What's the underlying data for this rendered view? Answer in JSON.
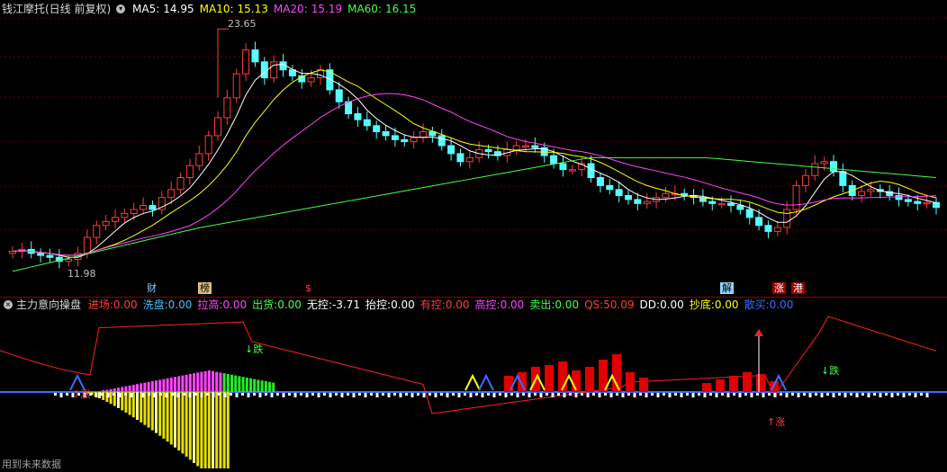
{
  "main_panel": {
    "title": "钱江摩托(日线 前复权)",
    "ma": [
      {
        "label": "MA5:",
        "value": "14.95",
        "color": "#ffffff"
      },
      {
        "label": "MA10:",
        "value": "15.13",
        "color": "#ffff00"
      },
      {
        "label": "MA20:",
        "value": "15.19",
        "color": "#ff44ff"
      },
      {
        "label": "MA60:",
        "value": "16.15",
        "color": "#44ff44"
      }
    ],
    "high_label": "23.65",
    "low_label": "11.98",
    "event_tags": [
      {
        "text": "财",
        "color": "#7fd0ff",
        "bg": "transparent"
      },
      {
        "text": "榜",
        "color": "#000000",
        "bg": "#d9c07a"
      },
      {
        "text": "$",
        "color": "#ff3b3b",
        "bg": "transparent"
      },
      {
        "text": "解",
        "color": "#000000",
        "bg": "#8fd8ff"
      },
      {
        "text": "涨",
        "color": "#ffffff",
        "bg": "#a00000"
      },
      {
        "text": "港",
        "color": "#ffffff",
        "bg": "#a00000"
      }
    ]
  },
  "sub_panel": {
    "title": "主力意向操盘",
    "indicators": [
      {
        "label": "进场:",
        "value": "0.00",
        "color": "#ff3b3b"
      },
      {
        "label": "洗盘:",
        "value": "0.00",
        "color": "#40c0ff"
      },
      {
        "label": "拉高:",
        "value": "0.00",
        "color": "#ff44ff"
      },
      {
        "label": "出货:",
        "value": "0.00",
        "color": "#44ff44"
      },
      {
        "label": "无控:",
        "value": "-3.71",
        "color": "#ffffff"
      },
      {
        "label": "抬控:",
        "value": "0.00",
        "color": "#ffffff"
      },
      {
        "label": "有控:",
        "value": "0.00",
        "color": "#ff3b3b"
      },
      {
        "label": "高控:",
        "value": "0.00",
        "color": "#ff44ff"
      },
      {
        "label": "卖出:",
        "value": "0.00",
        "color": "#44ff44"
      },
      {
        "label": "QS:",
        "value": "50.09",
        "color": "#ff3b3b"
      },
      {
        "label": "DD:",
        "value": "0.00",
        "color": "#ffffff"
      },
      {
        "label": "抄底:",
        "value": "0.00",
        "color": "#ffff00"
      },
      {
        "label": "散买:",
        "value": "0.00",
        "color": "#3b6bff"
      }
    ],
    "annotations": [
      {
        "text": "↓跌",
        "color": "#44ff44"
      },
      {
        "text": "↑涨",
        "color": "#ff3b3b"
      },
      {
        "text": "↓跌",
        "color": "#44ff44"
      },
      {
        "text": "↑涨",
        "color": "#ff3b3b"
      }
    ]
  },
  "footer": "用到未来数据",
  "chart_data": {
    "type": "candlestick",
    "close": [
      12.5,
      12.6,
      12.4,
      12.3,
      12.2,
      12.0,
      12.1,
      12.4,
      13.2,
      13.8,
      14.0,
      14.2,
      14.4,
      14.6,
      14.8,
      14.6,
      15.2,
      15.6,
      16.2,
      16.8,
      17.4,
      18.3,
      19.2,
      20.2,
      21.4,
      22.6,
      22.0,
      21.2,
      22.0,
      21.6,
      21.3,
      21.0,
      21.2,
      21.6,
      20.6,
      20.0,
      19.4,
      19.1,
      18.8,
      18.5,
      18.3,
      18.1,
      18.0,
      18.2,
      18.5,
      18.3,
      17.8,
      17.4,
      17.0,
      17.2,
      17.6,
      17.5,
      17.3,
      17.6,
      17.8,
      17.8,
      17.7,
      17.3,
      16.9,
      16.6,
      16.6,
      16.9,
      16.2,
      15.8,
      15.6,
      15.3,
      15.1,
      14.9,
      15.0,
      15.2,
      15.4,
      15.4,
      15.3,
      15.2,
      15.0,
      14.9,
      14.9,
      14.8,
      14.6,
      14.2,
      13.8,
      13.5,
      13.7,
      14.6,
      15.8,
      16.3,
      16.9,
      17.0,
      16.5,
      15.8,
      15.3,
      15.5,
      15.6,
      15.5,
      15.3,
      15.1,
      15.0,
      14.9,
      14.95,
      14.7
    ],
    "ma5_last": 14.95,
    "ma10_last": 15.13,
    "ma20_last": 15.19,
    "ma60_last": 16.15,
    "high": 23.65,
    "low": 11.98
  }
}
